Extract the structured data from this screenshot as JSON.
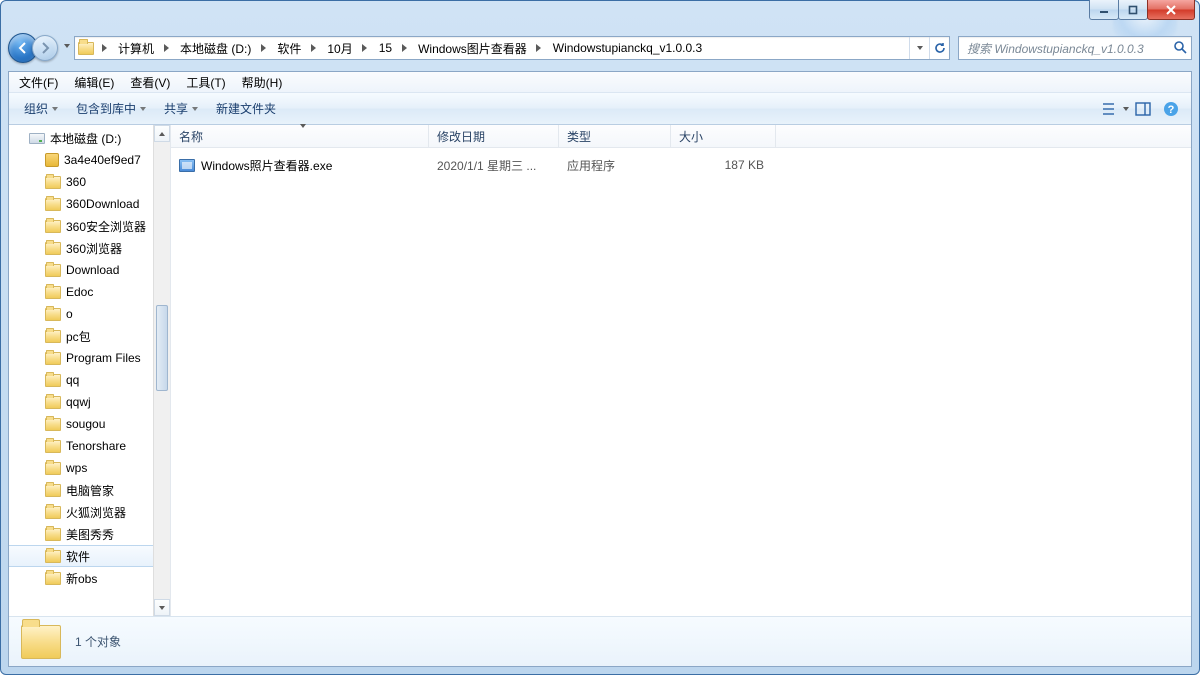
{
  "window_buttons": {
    "minimize": "minimize",
    "maximize": "maximize",
    "close": "close"
  },
  "breadcrumbs": [
    "计算机",
    "本地磁盘 (D:)",
    "软件",
    "10月",
    "15",
    "Windows图片查看器",
    "Windowstupianckq_v1.0.0.3"
  ],
  "search": {
    "placeholder": "搜索 Windowstupianckq_v1.0.0.3"
  },
  "menubar": {
    "file": "文件(F)",
    "edit": "编辑(E)",
    "view": "查看(V)",
    "tools": "工具(T)",
    "help": "帮助(H)"
  },
  "cmdbar": {
    "organize": "组织",
    "include": "包含到库中",
    "share": "共享",
    "newfolder": "新建文件夹"
  },
  "tree": {
    "drive": "本地磁盘 (D:)",
    "items": [
      "3a4e40ef9ed7",
      "360",
      "360Download",
      "360安全浏览器",
      "360浏览器",
      "Download",
      "Edoc",
      "o",
      "pc包",
      "Program Files",
      "qq",
      "qqwj",
      "sougou",
      "Tenorshare",
      "wps",
      "电脑管家",
      "火狐浏览器",
      "美图秀秀",
      "软件",
      "新obs"
    ],
    "selected_index": 18
  },
  "columns": {
    "name": "名称",
    "date": "修改日期",
    "type": "类型",
    "size": "大小"
  },
  "files": [
    {
      "name": "Windows照片查看器.exe",
      "date": "2020/1/1 星期三 ...",
      "type": "应用程序",
      "size": "187 KB"
    }
  ],
  "status": {
    "text": "1 个对象"
  }
}
